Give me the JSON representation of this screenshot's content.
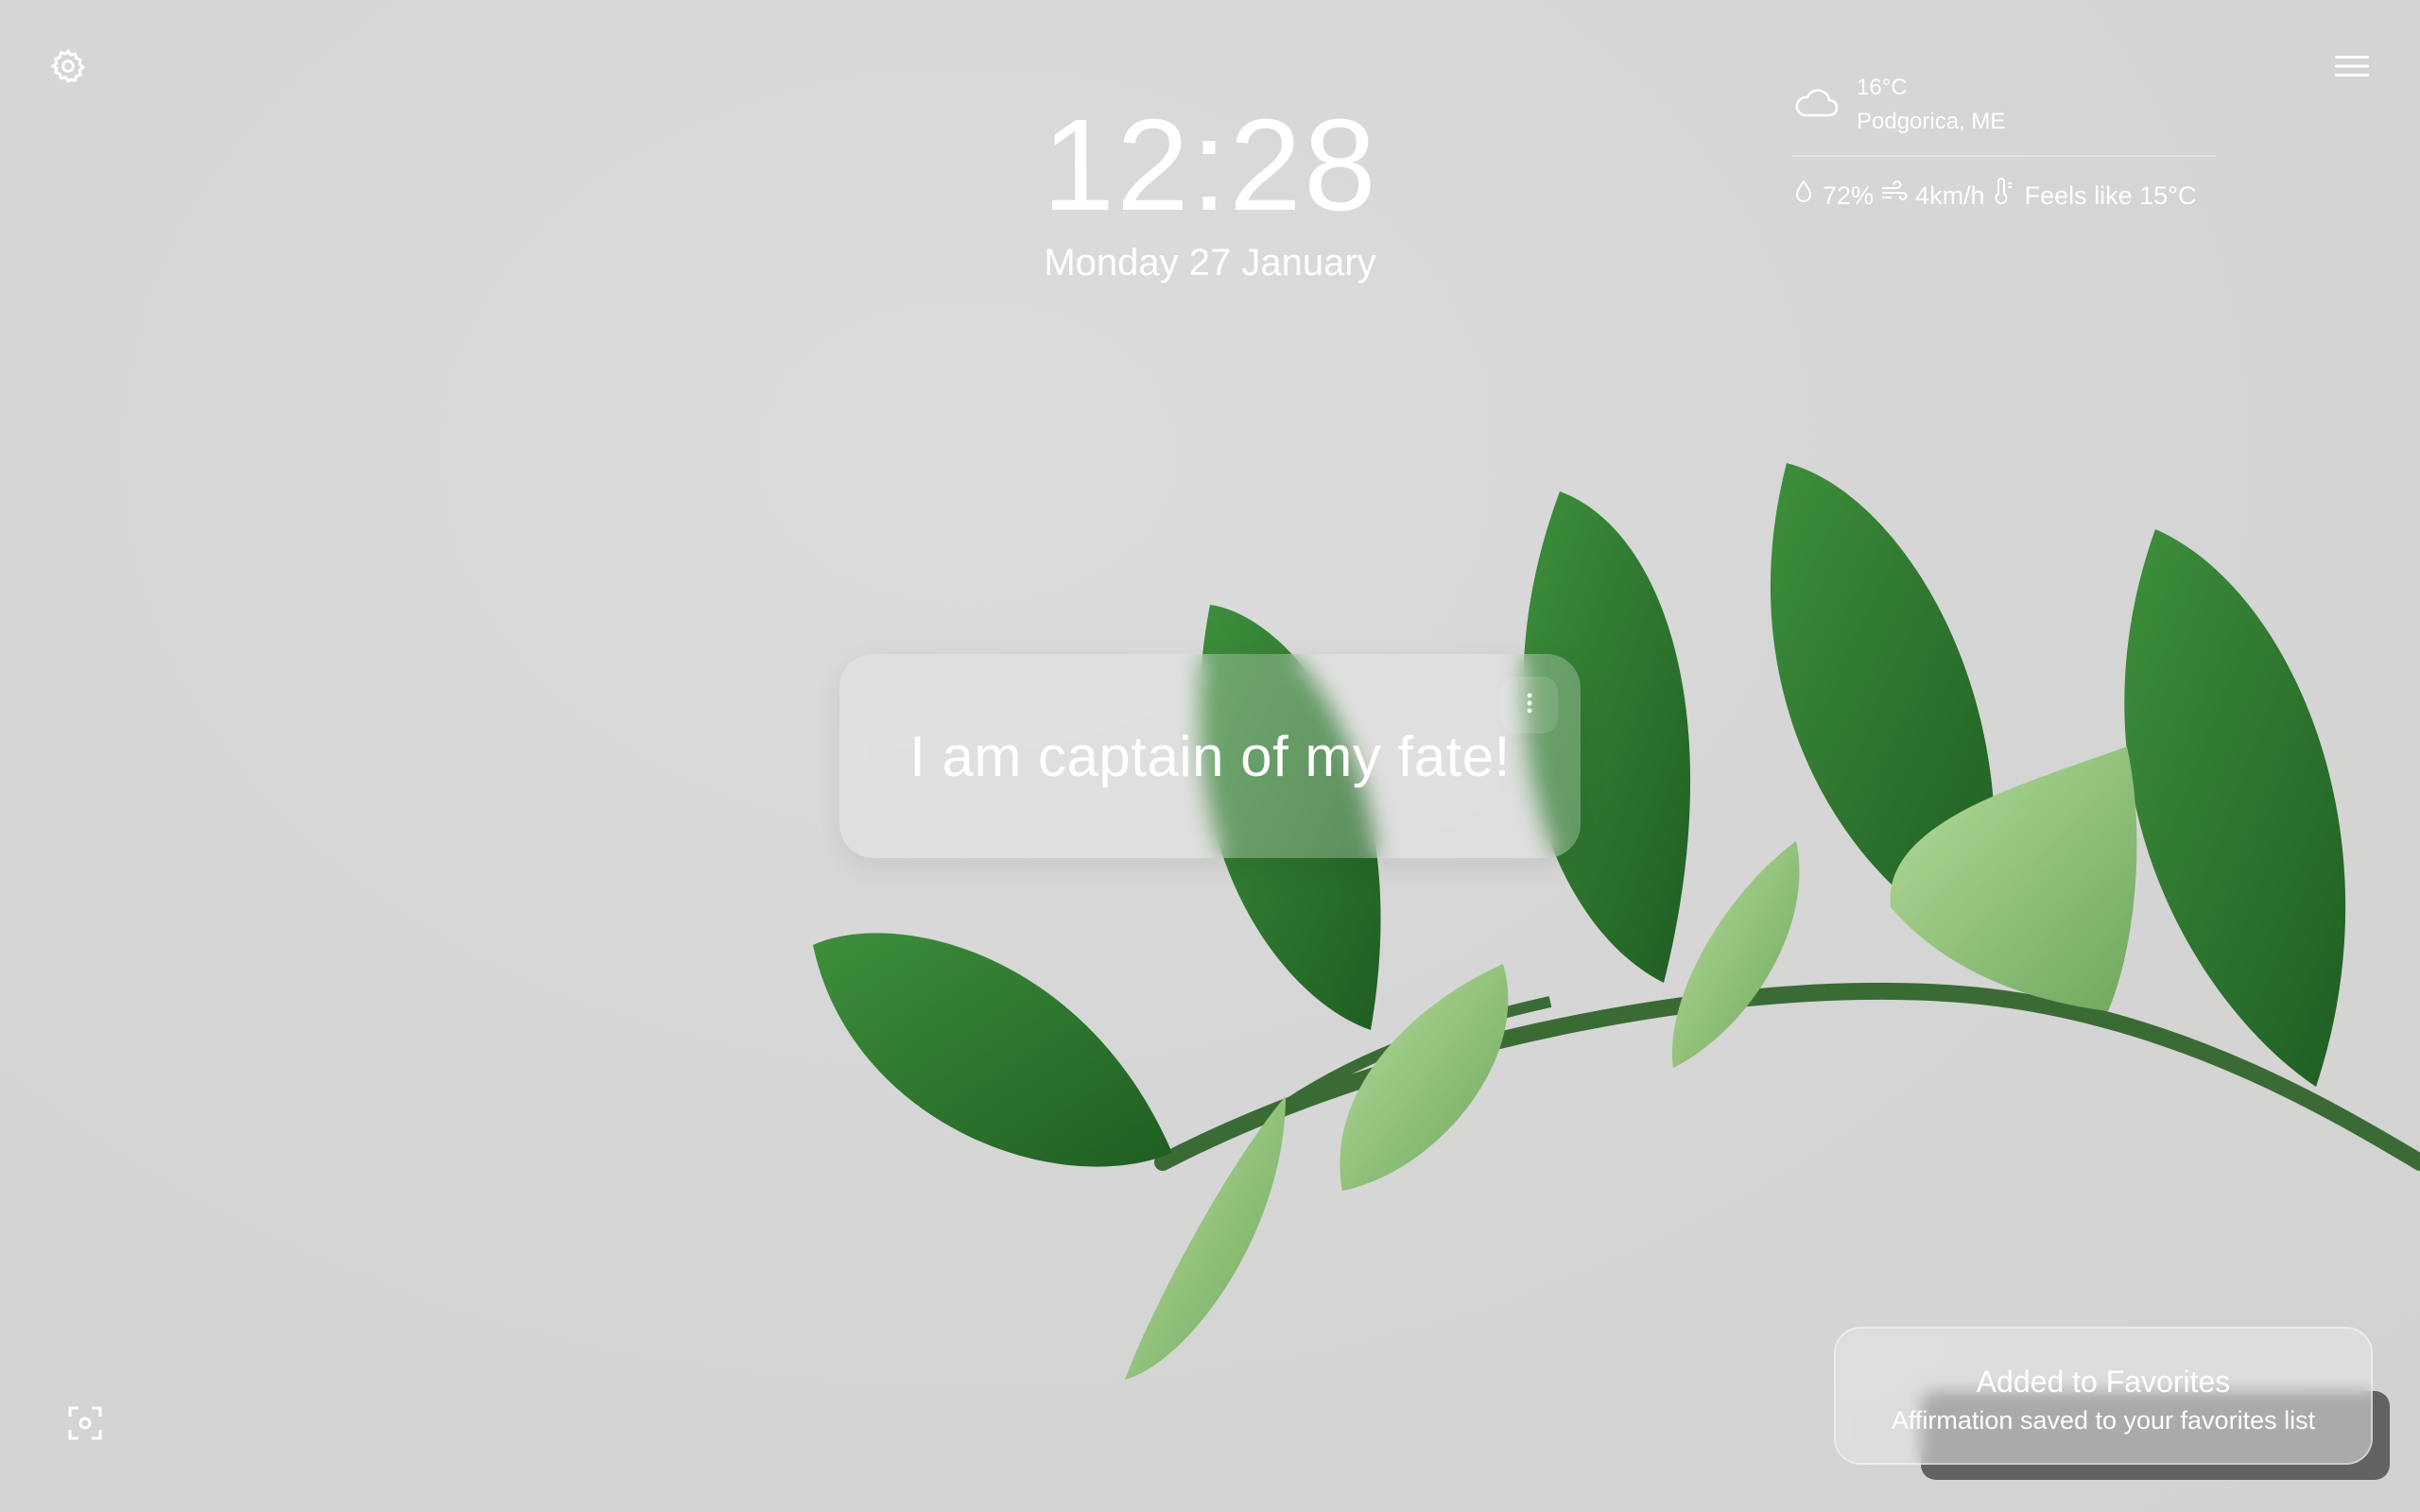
{
  "clock": {
    "time": "12:28",
    "date": "Monday 27 January"
  },
  "weather": {
    "temperature": "16°C",
    "location": "Podgorica, ME",
    "humidity": "72%",
    "wind": "4km/h",
    "feels_like": "Feels like 15°C",
    "condition_icon": "cloud-icon"
  },
  "affirmation": {
    "text": "I am captain of my fate!"
  },
  "toast": {
    "title": "Added to Favorites",
    "message": "Affirmation saved to your favorites list"
  },
  "icons": {
    "settings": "gear-icon",
    "menu": "hamburger-menu-icon",
    "capture": "screenshot-icon",
    "more": "more-vertical-icon"
  },
  "colors": {
    "background": "#d6d6d6",
    "text": "#ffffff",
    "leaf_dark": "#2f7a33",
    "leaf_light": "#8ec37a"
  }
}
